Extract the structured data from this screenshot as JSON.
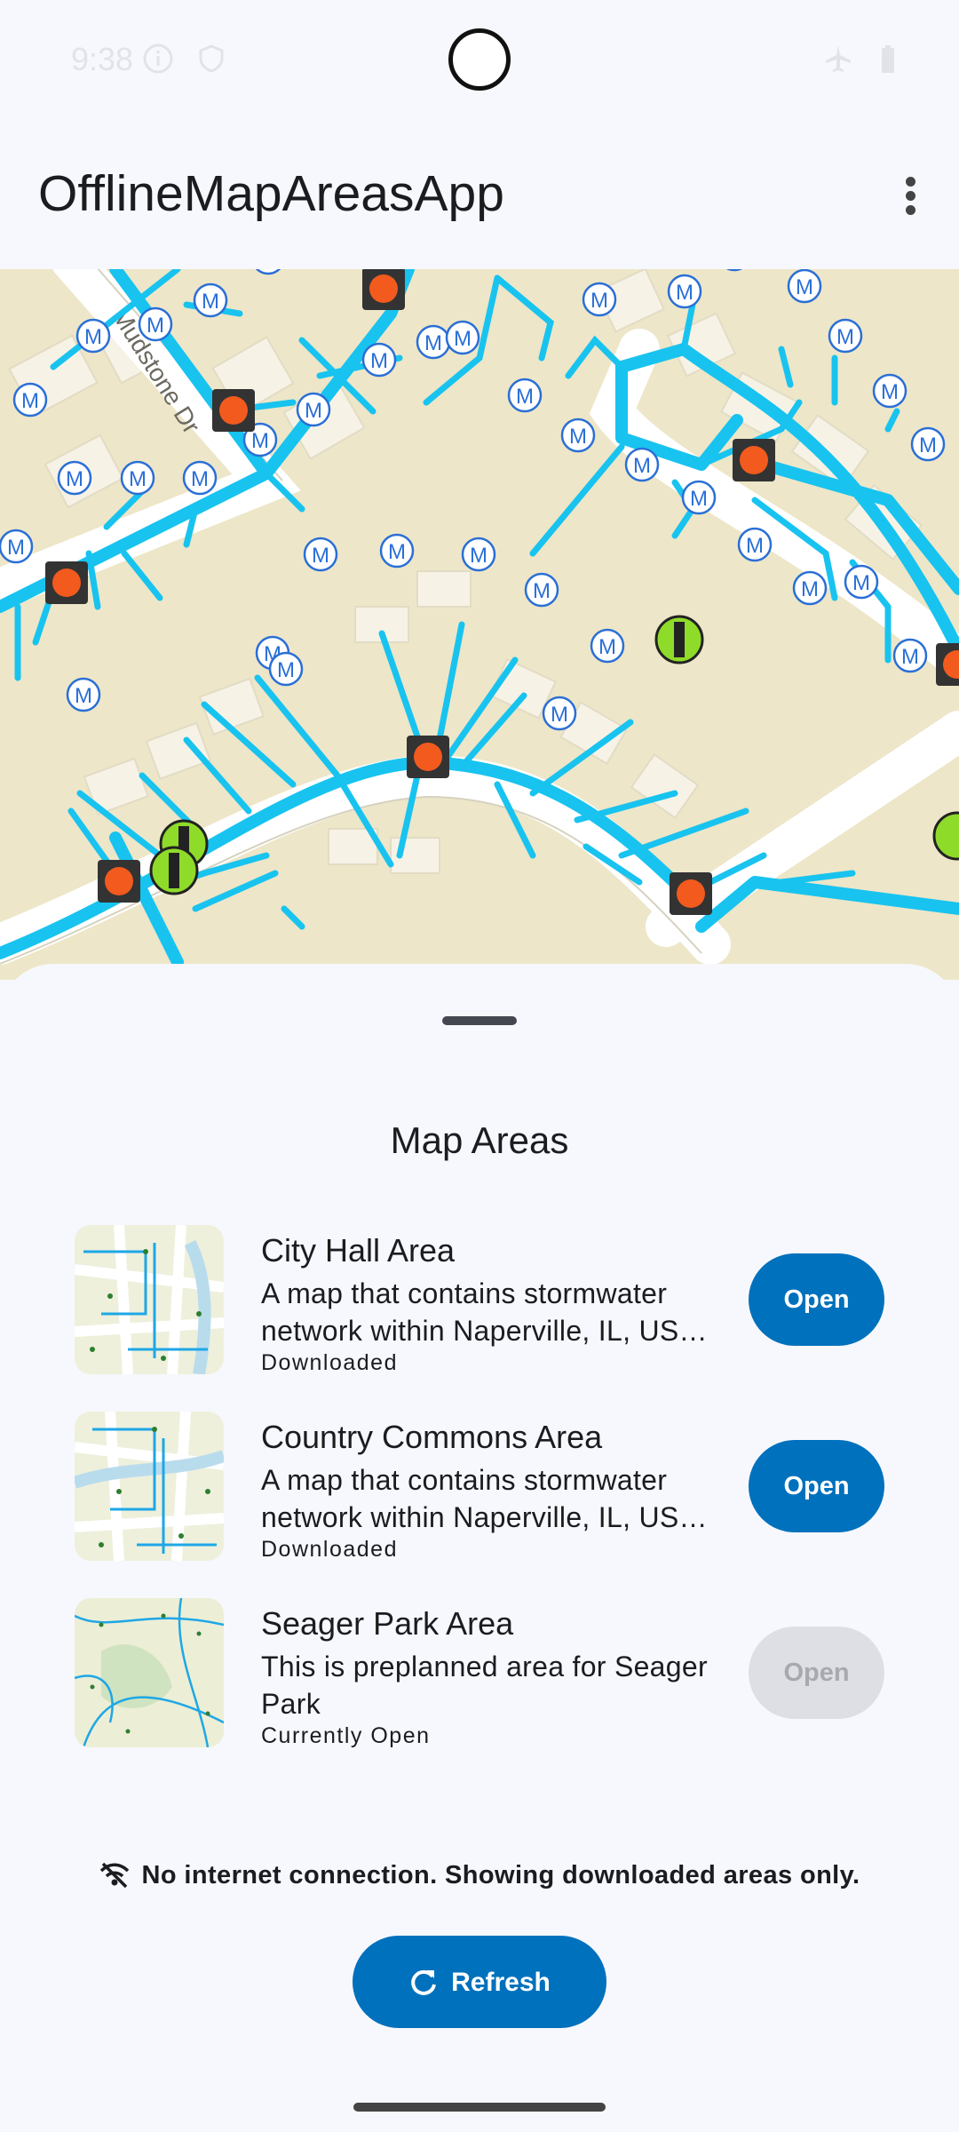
{
  "status_bar": {
    "time": "9:38",
    "icons": [
      "info-icon",
      "shield-icon",
      "airplane-icon",
      "battery-icon"
    ]
  },
  "app_bar": {
    "title": "OfflineMapAreasApp",
    "menu_icon": "more-vert-icon"
  },
  "sheet": {
    "title": "Map Areas",
    "areas": [
      {
        "name": "City Hall Area",
        "description": "A map that contains stormwater network within Naperville, IL, US…",
        "status": "Downloaded",
        "button_label": "Open",
        "button_enabled": true
      },
      {
        "name": "Country Commons Area",
        "description": "A map that contains stormwater network within Naperville, IL, US…",
        "status": "Downloaded",
        "button_label": "Open",
        "button_enabled": true
      },
      {
        "name": "Seager Park Area",
        "description": "This is preplanned area for Seager Park",
        "status": "Currently Open",
        "button_label": "Open",
        "button_enabled": false
      }
    ],
    "offline_message": "No internet connection. Showing downloaded areas only.",
    "offline_icon": "wifi-off-icon",
    "refresh_label": "Refresh",
    "refresh_icon": "refresh-icon"
  },
  "colors": {
    "accent": "#0071bc",
    "map_background": "#ede6c8",
    "pipe": "#18c3ef",
    "manhole": "#2a6fd6",
    "inlet": "#f25a1e",
    "outfall": "#8fdb2a"
  }
}
